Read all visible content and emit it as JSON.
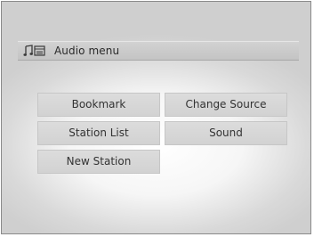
{
  "header": {
    "title": "Audio menu",
    "icon": "audio-music-icon"
  },
  "menu": {
    "items": [
      {
        "label": "Bookmark"
      },
      {
        "label": "Change Source"
      },
      {
        "label": "Station List"
      },
      {
        "label": "Sound"
      },
      {
        "label": "New Station"
      }
    ]
  },
  "colors": {
    "button_background": "#d6d6d6",
    "title_bar_background": "#c9c9c9",
    "text": "#333333",
    "frame_border": "#8a8a8a"
  }
}
